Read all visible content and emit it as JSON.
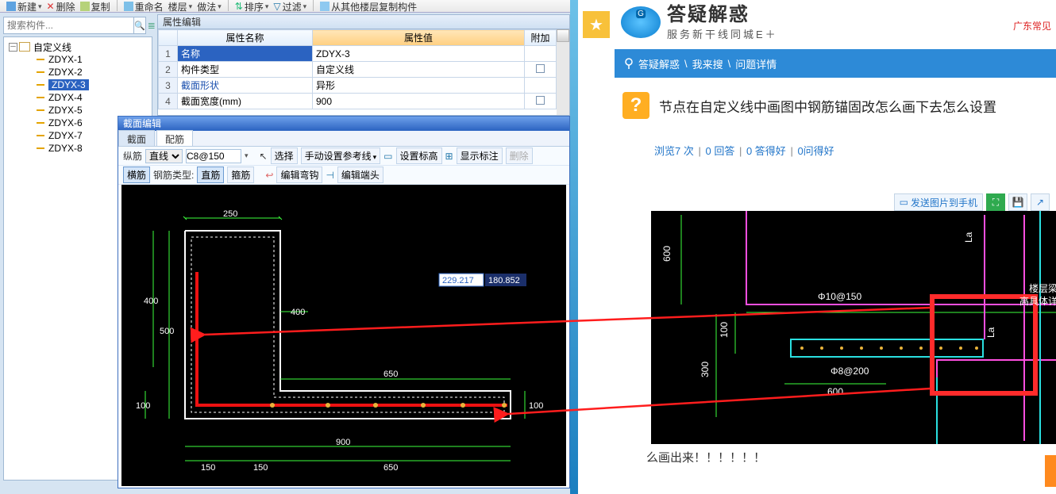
{
  "top_toolbar": {
    "new": "新建",
    "delete": "删除",
    "copy": "复制",
    "rename": "重命名",
    "floor": "楼层",
    "method": "做法",
    "sort": "排序",
    "filter": "过滤",
    "copy_from_floor": "从其他楼层复制构件"
  },
  "search": {
    "placeholder": "搜索构件..."
  },
  "tree": {
    "root": "自定义线",
    "items": [
      "ZDYX-1",
      "ZDYX-2",
      "ZDYX-3",
      "ZDYX-4",
      "ZDYX-5",
      "ZDYX-6",
      "ZDYX-7",
      "ZDYX-8"
    ],
    "selected_index": 2
  },
  "property_panel": {
    "title": "属性编辑",
    "headers": {
      "name": "属性名称",
      "value": "属性值",
      "addon": "附加"
    },
    "rows": [
      {
        "idx": "1",
        "name": "名称",
        "value": "ZDYX-3",
        "addon": false,
        "name_highlight": true
      },
      {
        "idx": "2",
        "name": "构件类型",
        "value": "自定义线",
        "addon": true
      },
      {
        "idx": "3",
        "name": "截面形状",
        "value": "异形",
        "addon": false,
        "blue": true
      },
      {
        "idx": "4",
        "name": "截面宽度(mm)",
        "value": "900",
        "addon": true
      }
    ]
  },
  "section_editor": {
    "title": "截面编辑",
    "tabs": [
      "截面",
      "配筋"
    ],
    "active_tab_index": 1,
    "row1": {
      "label": "纵筋",
      "mode": "直线",
      "spec": "C8@150",
      "select": "选择",
      "manual_ref": "手动设置参考线",
      "set_elev": "设置标高",
      "show_anno": "显示标注",
      "delete": "删除"
    },
    "row2": {
      "label": "横筋",
      "type_label": "钢筋类型:",
      "btn_line": "直筋",
      "btn_stirrup": "箍筋",
      "edit_hook": "编辑弯钩",
      "edit_end": "编辑端头"
    },
    "canvas": {
      "dims": {
        "d250": "250",
        "d400l": "400",
        "d400r": "400",
        "d500": "500",
        "d650": "650",
        "d100a": "100",
        "d100b": "100",
        "d900": "900",
        "d150a": "150",
        "d150b": "150",
        "d650b": "650"
      },
      "coord_sel": "229.217",
      "coord_y": "180.852"
    }
  },
  "browser": {
    "brand_title": "答疑解惑",
    "brand_sub": "服务新干线同城E＋",
    "location_suffix": "广东常见",
    "breadcrumb": {
      "root": "答疑解惑",
      "mid": "我来搜",
      "leaf": "问题详情"
    },
    "question_title": "节点在自定义线中画图中钢筋锚固改怎么画下去怎么设置",
    "stats": {
      "views": "浏览7 次",
      "answers": "0 回答",
      "good_a": "0 答得好",
      "good_q": "0问得好"
    },
    "img_toolbar": {
      "send_phone": "发送图片到手机"
    },
    "answer_text": "么画出来！！！！！！",
    "cad": {
      "spec_top": "Φ10@150",
      "spec_bot": "Φ8@200",
      "d600a": "600",
      "d100": "100",
      "d300": "300",
      "d600b": "600",
      "label1": "楼层梁",
      "label2": "高具体详结构",
      "la": "La"
    }
  }
}
